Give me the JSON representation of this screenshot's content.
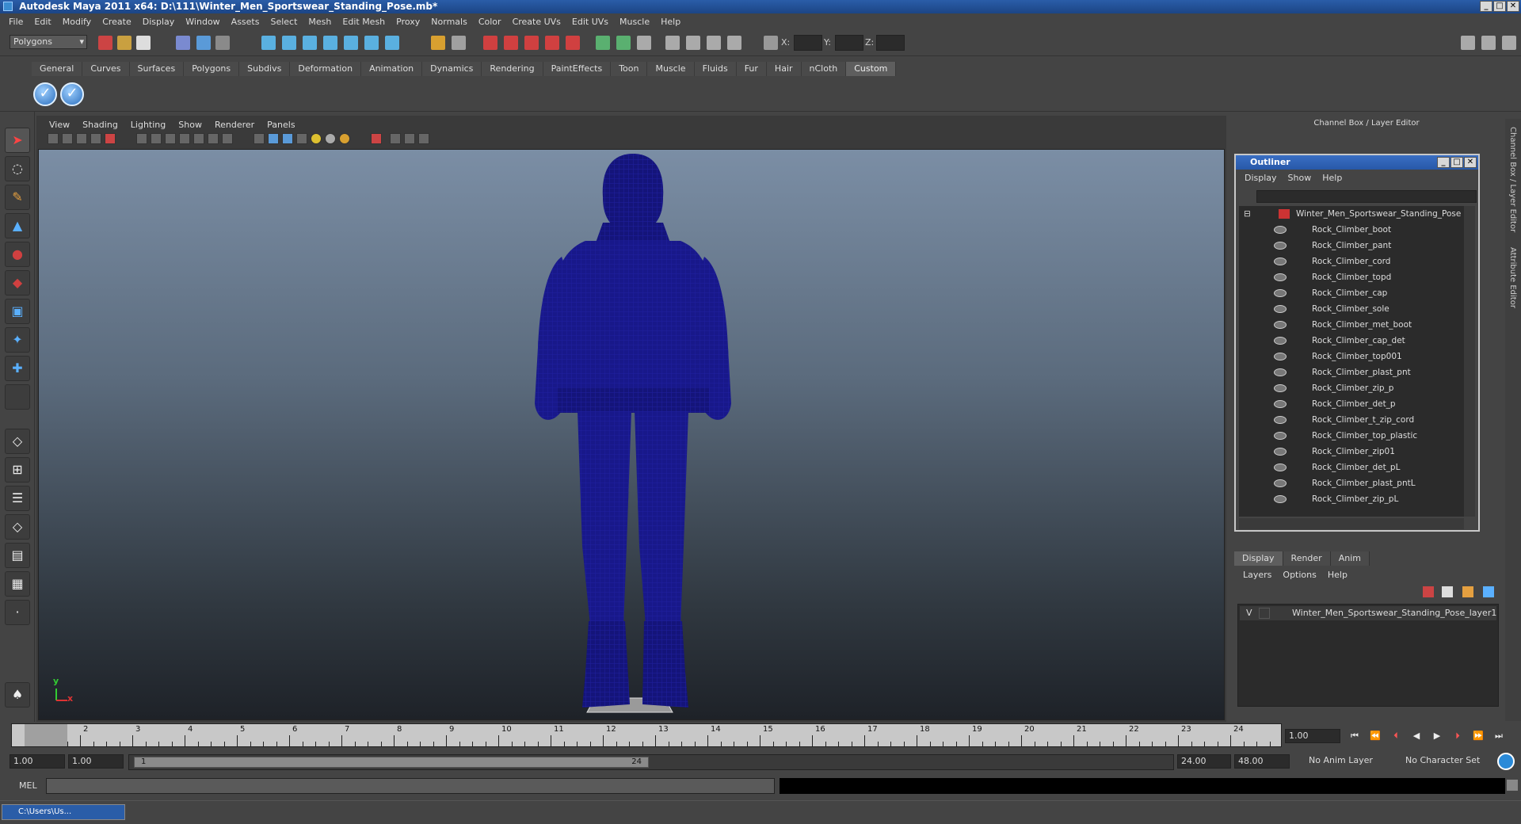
{
  "window": {
    "title": "Autodesk Maya 2011 x64: D:\\111\\Winter_Men_Sportswear_Standing_Pose.mb*",
    "controls": [
      "_",
      "□",
      "✕"
    ]
  },
  "menubar": [
    "File",
    "Edit",
    "Modify",
    "Create",
    "Display",
    "Window",
    "Assets",
    "Select",
    "Mesh",
    "Edit Mesh",
    "Proxy",
    "Normals",
    "Color",
    "Create UVs",
    "Edit UVs",
    "Muscle",
    "Help"
  ],
  "statusline": {
    "mode": "Polygons",
    "x_label": "X:",
    "y_label": "Y:",
    "z_label": "Z:"
  },
  "shelf": {
    "tabs": [
      "General",
      "Curves",
      "Surfaces",
      "Polygons",
      "Subdivs",
      "Deformation",
      "Animation",
      "Dynamics",
      "Rendering",
      "PaintEffects",
      "Toon",
      "Muscle",
      "Fluids",
      "Fur",
      "Hair",
      "nCloth",
      "Custom"
    ],
    "active_tab": "Custom"
  },
  "viewport": {
    "menu": [
      "View",
      "Shading",
      "Lighting",
      "Show",
      "Renderer",
      "Panels"
    ],
    "axis_y": "y",
    "axis_x": "x",
    "wire_color": "#1a1a8a"
  },
  "channelbox": {
    "title": "Channel Box / Layer Editor"
  },
  "side_tabs": {
    "channel": "Channel Box / Layer Editor",
    "attribute": "Attribute Editor"
  },
  "outliner": {
    "title": "Outliner",
    "menu": [
      "Display",
      "Show",
      "Help"
    ],
    "root": "Winter_Men_Sportswear_Standing_Pose",
    "items": [
      "Rock_Climber_boot",
      "Rock_Climber_pant",
      "Rock_Climber_cord",
      "Rock_Climber_topd",
      "Rock_Climber_cap",
      "Rock_Climber_sole",
      "Rock_Climber_met_boot",
      "Rock_Climber_cap_det",
      "Rock_Climber_top001",
      "Rock_Climber_plast_pnt",
      "Rock_Climber_zip_p",
      "Rock_Climber_det_p",
      "Rock_Climber_t_zip_cord",
      "Rock_Climber_top_plastic",
      "Rock_Climber_zip01",
      "Rock_Climber_det_pL",
      "Rock_Climber_plast_pntL",
      "Rock_Climber_zip_pL"
    ]
  },
  "layers": {
    "tabs": [
      "Display",
      "Render",
      "Anim"
    ],
    "active_tab": "Display",
    "menu": [
      "Layers",
      "Options",
      "Help"
    ],
    "layer_vis": "V",
    "layer_name": "Winter_Men_Sportswear_Standing_Pose_layer1"
  },
  "timeline": {
    "start_label": "1",
    "ticks": [
      "1",
      "2",
      "3",
      "4",
      "5",
      "6",
      "7",
      "8",
      "9",
      "10",
      "11",
      "12",
      "13",
      "14",
      "15",
      "16",
      "17",
      "18",
      "19",
      "20",
      "21",
      "22",
      "23",
      "24"
    ],
    "current_frame": "1.00"
  },
  "range": {
    "start": "1.00",
    "anim_start": "1.00",
    "slider_start": "1",
    "slider_end": "24",
    "end": "24.00",
    "anim_end": "48.00",
    "anim_layer": "No Anim Layer",
    "char_set": "No Character Set"
  },
  "cmd": {
    "label": "MEL"
  },
  "taskbar": {
    "item": "C:\\Users\\Us..."
  }
}
